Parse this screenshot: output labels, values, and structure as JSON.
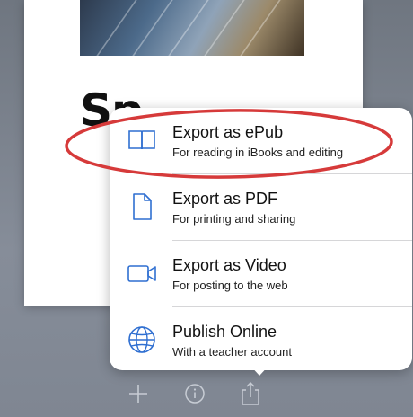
{
  "book": {
    "title_text": "Sp"
  },
  "export_menu": {
    "items": [
      {
        "title": "Export as ePub",
        "subtitle": "For reading in iBooks and editing",
        "icon": "book-icon"
      },
      {
        "title": "Export as PDF",
        "subtitle": "For printing and sharing",
        "icon": "document-icon"
      },
      {
        "title": "Export as Video",
        "subtitle": "For posting to the web",
        "icon": "video-camera-icon"
      },
      {
        "title": "Publish Online",
        "subtitle": "With a teacher account",
        "icon": "globe-icon"
      }
    ]
  },
  "toolbar": {
    "buttons": [
      {
        "icon": "plus-icon"
      },
      {
        "icon": "info-icon"
      },
      {
        "icon": "share-icon"
      }
    ]
  },
  "colors": {
    "icon_blue": "#2f6fd1",
    "highlight_red": "#d63a3a",
    "background": "#7e8591"
  }
}
